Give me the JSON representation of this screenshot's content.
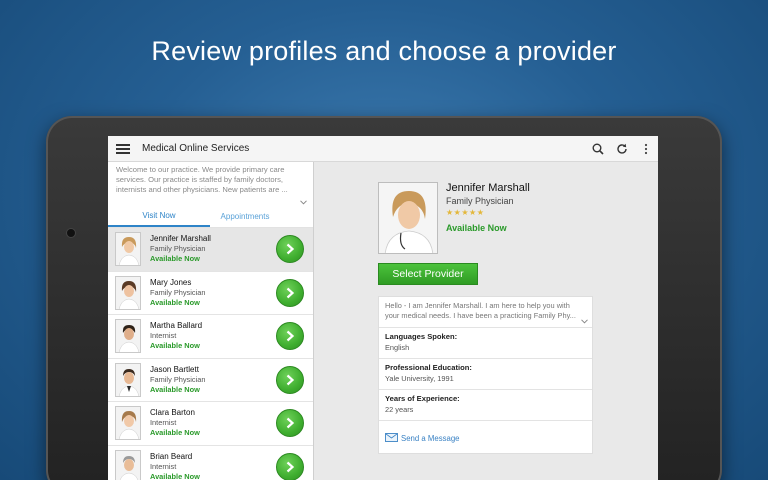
{
  "headline": "Review profiles and choose a provider",
  "app": {
    "title": "Medical Online Services",
    "icons": [
      "menu-icon",
      "search-icon",
      "refresh-icon",
      "overflow-icon"
    ]
  },
  "intro": "Welcome to our practice. We provide primary care services. Our practice is staffed by family doctors, internists and other physicians. New patients are ...",
  "tabs": {
    "visit_now": "Visit Now",
    "appointments": "Appointments"
  },
  "providers": [
    {
      "name": "Jennifer Marshall",
      "title": "Family Physician",
      "status": "Available Now"
    },
    {
      "name": "Mary Jones",
      "title": "Family Physician",
      "status": "Available Now"
    },
    {
      "name": "Martha Ballard",
      "title": "Internist",
      "status": "Available Now"
    },
    {
      "name": "Jason Bartlett",
      "title": "Family Physician",
      "status": "Available Now"
    },
    {
      "name": "Clara Barton",
      "title": "Internist",
      "status": "Available Now"
    },
    {
      "name": "Brian Beard",
      "title": "Internist",
      "status": "Available Now"
    }
  ],
  "profile": {
    "name": "Jennifer Marshall",
    "title": "Family Physician",
    "stars": "★★★★★",
    "status": "Available Now",
    "select_label": "Select Provider",
    "bio": "Hello - I am Jennifer Marshall. I am here to help you with your medical needs. I have been a practicing Family Phy...",
    "languages_label": "Languages Spoken:",
    "languages_value": "English",
    "education_label": "Professional Education:",
    "education_value": "Yale University, 1991",
    "experience_label": "Years of Experience:",
    "experience_value": "22 years",
    "message_label": "Send a Message"
  },
  "colors": {
    "accent": "#2e84c8",
    "available": "#2a9a2a",
    "go_button": "#3fae2f"
  }
}
